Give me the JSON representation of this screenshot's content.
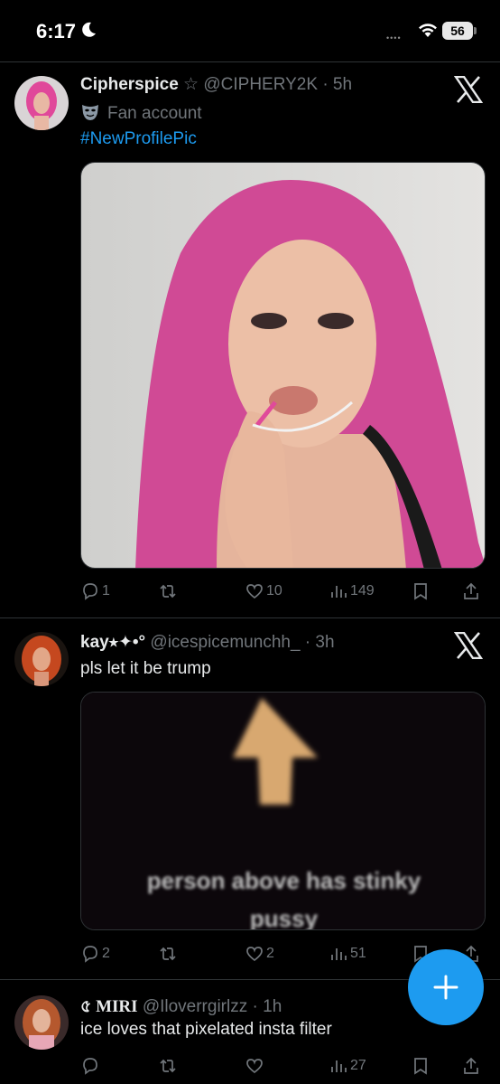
{
  "status_bar": {
    "time": "6:17",
    "battery": "56"
  },
  "tweets": [
    {
      "name": "Cipherspice",
      "name_badge": "☆",
      "handle": "@CIPHERY2K",
      "time": "· 5h",
      "label": "Fan account",
      "text": "#NewProfilePic",
      "replies": "1",
      "retweets": "",
      "likes": "10",
      "views": "149"
    },
    {
      "name": "kay⭑✦•°",
      "handle": "@icespicemunchh_",
      "time": "· 3h",
      "text": "pls let it be trump",
      "image_caption_line1": "person above has stinky",
      "image_caption_line2": "pussy",
      "replies": "2",
      "retweets": "",
      "likes": "2",
      "views": "51"
    },
    {
      "name": "৫ MIRI",
      "handle": "@Iloverrgirlzz",
      "time": "· 1h",
      "text": "ice loves that pixelated insta filter",
      "replies": "",
      "retweets": "",
      "likes": "",
      "views": "27"
    }
  ],
  "colors": {
    "accent": "#1d9bf0",
    "muted": "#71767b",
    "background": "#000000"
  },
  "icons": [
    "moon-icon",
    "wifi-icon",
    "x-logo-icon",
    "mask-icon",
    "reply-icon",
    "retweet-icon",
    "like-icon",
    "views-icon",
    "bookmark-icon",
    "share-icon",
    "compose-plus-icon"
  ]
}
